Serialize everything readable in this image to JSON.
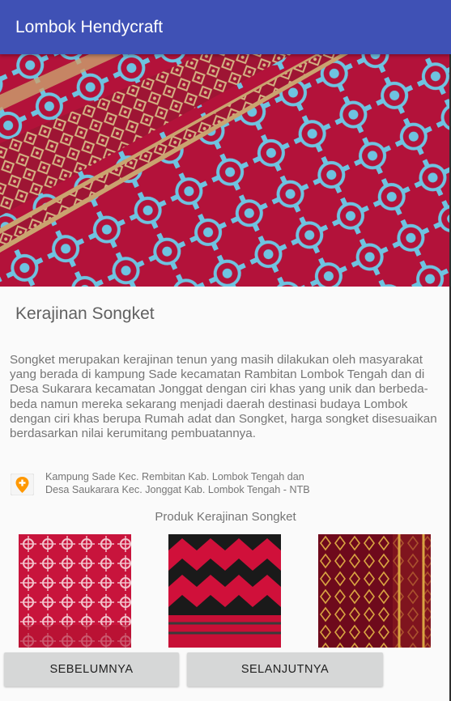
{
  "app": {
    "title": "Lombok Hendycraft"
  },
  "content": {
    "section_title": "Kerajinan Songket",
    "description": "Songket merupakan kerajinan tenun yang masih dilakukan oleh masyarakat yang berada di kampung Sade kecamatan Rambitan Lombok Tengah dan di Desa Sukarara kecamatan Jonggat dengan ciri khas yang unik dan berbeda-beda namun mereka sekarang menjadi daerah destinasi budaya Lombok dengan ciri khas berupa Rumah adat dan Songket, harga songket disesuaikan berdasarkan nilai kerumitang pembuatannya.",
    "location_line1": "Kampung Sade Kec. Rembitan Kab. Lombok Tengah  dan",
    "location_line2": "Desa Saukarara Kec. Jonggat Kab. Lombok Tengah - NTB",
    "location_icon": "map-marker-icon",
    "products_title": "Produk Kerajinan Songket"
  },
  "buttons": {
    "previous": "SEBELUMNYA",
    "next": "SELANJUTNYA"
  },
  "colors": {
    "appbar": "#3f51b5",
    "button": "#d6d7d7",
    "location_icon": "#ff9800"
  }
}
